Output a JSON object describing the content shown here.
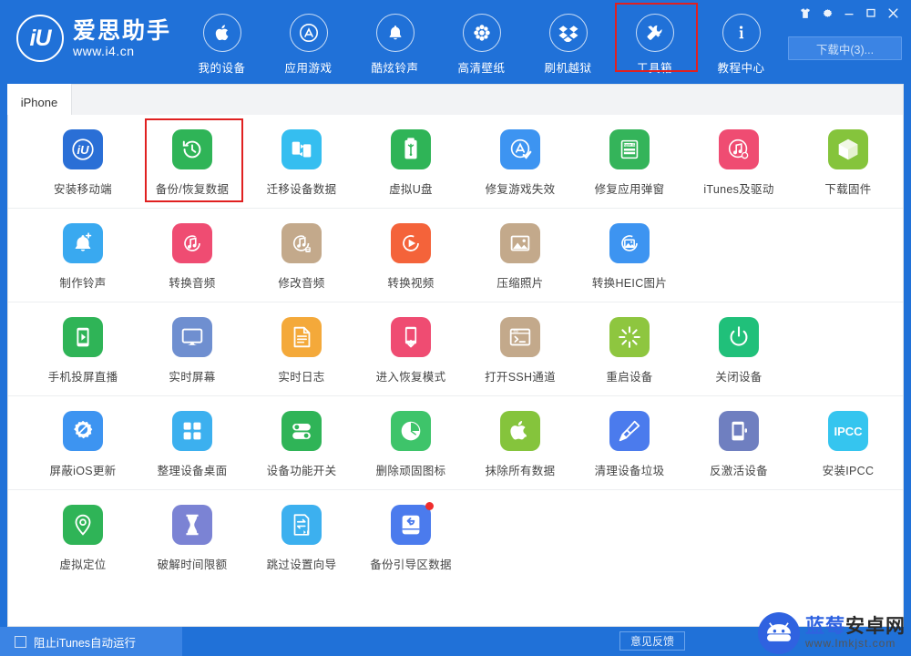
{
  "app": {
    "brand_name": "爱思助手",
    "brand_url": "www.i4.cn",
    "logo_mark": "iU",
    "accent_blue": "#2071d8",
    "highlight_red": "#e02020"
  },
  "header": {
    "nav": [
      {
        "label": "我的设备",
        "icon": "apple-icon",
        "selected": false
      },
      {
        "label": "应用游戏",
        "icon": "appstore-icon",
        "selected": false
      },
      {
        "label": "酷炫铃声",
        "icon": "bell-icon",
        "selected": false
      },
      {
        "label": "高清壁纸",
        "icon": "flower-icon",
        "selected": false
      },
      {
        "label": "刷机越狱",
        "icon": "box-icon",
        "selected": false
      },
      {
        "label": "工具箱",
        "icon": "tools-icon",
        "selected": true
      },
      {
        "label": "教程中心",
        "icon": "info-icon",
        "selected": false
      }
    ],
    "window_controls": [
      {
        "name": "skin-icon",
        "glyph": "👕"
      },
      {
        "name": "settings-gear-icon",
        "glyph": "⚙"
      },
      {
        "name": "minimize-icon",
        "glyph": "—"
      },
      {
        "name": "maximize-icon",
        "glyph": "▢"
      },
      {
        "name": "close-icon",
        "glyph": "✕"
      }
    ],
    "download_button": "下载中(3)..."
  },
  "tabs": [
    {
      "label": "iPhone",
      "active": true
    }
  ],
  "toolbox": {
    "rows": [
      {
        "items": [
          {
            "label": "安装移动端",
            "icon": "i4-app-icon",
            "bg": "#2a6fd6",
            "selected": false
          },
          {
            "label": "备份/恢复数据",
            "icon": "backup-restore-icon",
            "bg": "#2fb457",
            "selected": true
          },
          {
            "label": "迁移设备数据",
            "icon": "migrate-device-icon",
            "bg": "#35bef0",
            "selected": false
          },
          {
            "label": "虚拟U盘",
            "icon": "usb-drive-icon",
            "bg": "#2fb457",
            "selected": false
          },
          {
            "label": "修复游戏失效",
            "icon": "fix-game-icon",
            "bg": "#3d94f1",
            "selected": false
          },
          {
            "label": "修复应用弹窗",
            "icon": "apple-id-icon",
            "bg": "#34b45a",
            "selected": false
          },
          {
            "label": "iTunes及驱动",
            "icon": "itunes-driver-icon",
            "bg": "#ef4c72",
            "selected": false
          },
          {
            "label": "下载固件",
            "icon": "firmware-cube-icon",
            "bg": "#85c43c",
            "selected": false
          }
        ]
      },
      {
        "items": [
          {
            "label": "制作铃声",
            "icon": "make-ringtone-icon",
            "bg": "#39a9f0",
            "selected": false
          },
          {
            "label": "转换音频",
            "icon": "convert-audio-icon",
            "bg": "#ef4c72",
            "selected": false
          },
          {
            "label": "修改音频",
            "icon": "edit-audio-icon",
            "bg": "#c3a98b",
            "selected": false
          },
          {
            "label": "转换视频",
            "icon": "convert-video-icon",
            "bg": "#f4633a",
            "selected": false
          },
          {
            "label": "压缩照片",
            "icon": "compress-photo-icon",
            "bg": "#c3a98b",
            "selected": false
          },
          {
            "label": "转换HEIC图片",
            "icon": "convert-heic-icon",
            "bg": "#3d94f1",
            "selected": false
          }
        ]
      },
      {
        "items": [
          {
            "label": "手机投屏直播",
            "icon": "screen-cast-icon",
            "bg": "#2fb457",
            "selected": false
          },
          {
            "label": "实时屏幕",
            "icon": "realtime-screen-icon",
            "bg": "#6f8fd0",
            "selected": false
          },
          {
            "label": "实时日志",
            "icon": "realtime-log-icon",
            "bg": "#f4a93a",
            "selected": false
          },
          {
            "label": "进入恢复模式",
            "icon": "recovery-mode-icon",
            "bg": "#ef4c72",
            "selected": false
          },
          {
            "label": "打开SSH通道",
            "icon": "ssh-tunnel-icon",
            "bg": "#c3a98b",
            "selected": false
          },
          {
            "label": "重启设备",
            "icon": "reboot-device-icon",
            "bg": "#8ec63f",
            "selected": false
          },
          {
            "label": "关闭设备",
            "icon": "shutdown-device-icon",
            "bg": "#20c07a",
            "selected": false
          }
        ]
      },
      {
        "items": [
          {
            "label": "屏蔽iOS更新",
            "icon": "block-ios-update-icon",
            "bg": "#3d94f1",
            "selected": false
          },
          {
            "label": "整理设备桌面",
            "icon": "arrange-desktop-icon",
            "bg": "#3cb0ef",
            "selected": false
          },
          {
            "label": "设备功能开关",
            "icon": "feature-toggle-icon",
            "bg": "#2fb457",
            "selected": false
          },
          {
            "label": "删除顽固图标",
            "icon": "delete-stubborn-icon",
            "bg": "#3ec46a",
            "selected": false
          },
          {
            "label": "抹除所有数据",
            "icon": "erase-all-data-icon",
            "bg": "#85c43c",
            "selected": false
          },
          {
            "label": "清理设备垃圾",
            "icon": "clean-junk-icon",
            "bg": "#4b7bed",
            "selected": false
          },
          {
            "label": "反激活设备",
            "icon": "deactivate-device-icon",
            "bg": "#6f7fc0",
            "selected": false
          },
          {
            "label": "安装IPCC",
            "icon": "install-ipcc-icon",
            "bg": "#35c5ef",
            "selected": false,
            "text": "IPCC"
          }
        ]
      },
      {
        "items": [
          {
            "label": "虚拟定位",
            "icon": "virtual-location-icon",
            "bg": "#2fb457",
            "selected": false
          },
          {
            "label": "破解时间限额",
            "icon": "crack-time-limit-icon",
            "bg": "#7b83d4",
            "selected": false
          },
          {
            "label": "跳过设置向导",
            "icon": "skip-setup-icon",
            "bg": "#3cb0ef",
            "selected": false
          },
          {
            "label": "备份引导区数据",
            "icon": "backup-boot-icon",
            "bg": "#4b7bed",
            "selected": false,
            "badge": true
          }
        ]
      }
    ]
  },
  "footer": {
    "block_itunes_label": "阻止iTunes自动运行",
    "block_itunes_checked": false,
    "feedback_label": "意见反馈"
  },
  "watermark": {
    "name_blue": "蓝莓",
    "name_dark": "安卓网",
    "url": "www.lmkjst.com"
  }
}
